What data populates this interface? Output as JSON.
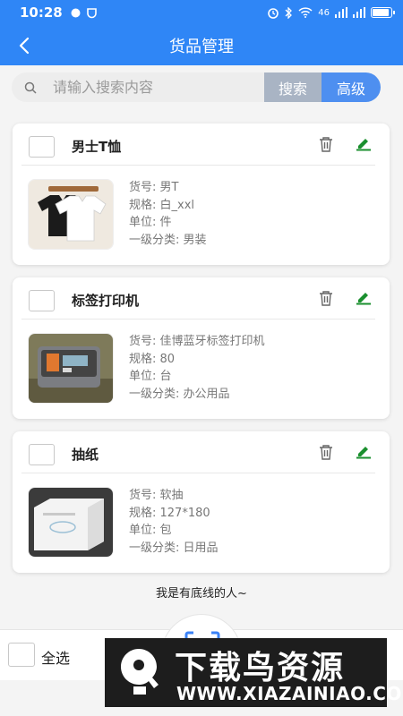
{
  "status_bar": {
    "time": "10:28",
    "network": "46"
  },
  "header": {
    "title": "货品管理"
  },
  "search": {
    "placeholder": "请输入搜索内容",
    "search_label": "搜索",
    "advanced_label": "高级"
  },
  "items": [
    {
      "name": "男士T恤",
      "code_label": "货号: 男T",
      "spec_label": "规格: 白_xxl",
      "unit_label": "单位: 件",
      "category_label": "一级分类: 男装"
    },
    {
      "name": "标签打印机",
      "code_label": "货号: 佳博蓝牙标签打印机",
      "spec_label": "规格: 80",
      "unit_label": "单位: 台",
      "category_label": "一级分类: 办公用品"
    },
    {
      "name": "抽纸",
      "code_label": "货号: 软抽",
      "spec_label": "规格: 127*180",
      "unit_label": "单位: 包",
      "category_label": "一级分类: 日用品"
    }
  ],
  "footer": {
    "end_text": "我是有底线的人~"
  },
  "bottom_bar": {
    "select_all_label": "全选"
  },
  "watermark": {
    "title": "下载鸟资源",
    "url": "WWW.XIAZAINIAO.COM"
  },
  "colors": {
    "primary": "#2f86f6",
    "edit": "#1a8f2e",
    "search_btn": "#a9b4c4",
    "advanced_btn": "#4e8ff0"
  }
}
